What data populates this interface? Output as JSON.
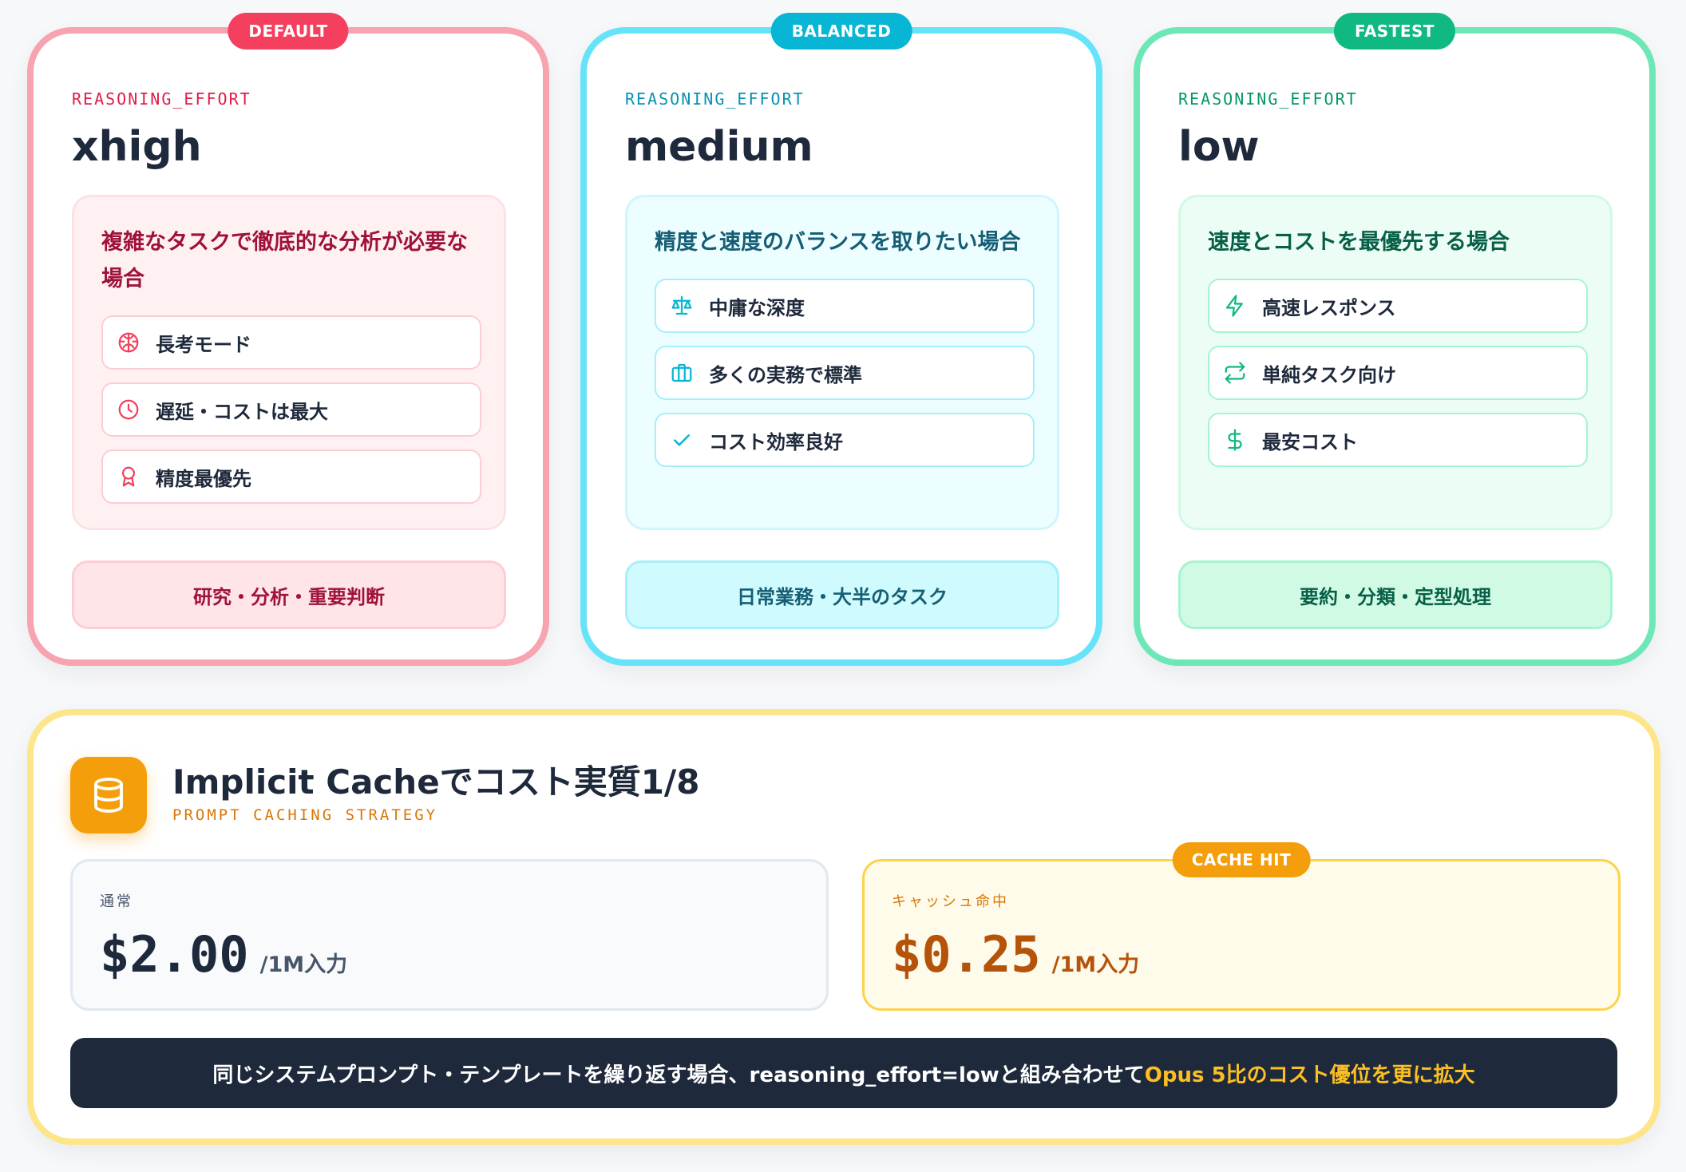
{
  "cards": [
    {
      "badge": "DEFAULT",
      "eyebrow": "REASONING_EFFORT",
      "level": "xhigh",
      "description": "複雑なタスクで徹底的な分析が必要な場合",
      "features": [
        {
          "icon": "brain-icon",
          "label": "長考モード"
        },
        {
          "icon": "clock-icon",
          "label": "遅延・コストは最大"
        },
        {
          "icon": "award-icon",
          "label": "精度最優先"
        }
      ],
      "use_case": "研究・分析・重要判断",
      "accent_color": "#f43f5e"
    },
    {
      "badge": "BALANCED",
      "eyebrow": "REASONING_EFFORT",
      "level": "medium",
      "description": "精度と速度のバランスを取りたい場合",
      "features": [
        {
          "icon": "scale-icon",
          "label": "中庸な深度"
        },
        {
          "icon": "briefcase-icon",
          "label": "多くの実務で標準"
        },
        {
          "icon": "check-icon",
          "label": "コスト効率良好"
        }
      ],
      "use_case": "日常業務・大半のタスク",
      "accent_color": "#06b6d4"
    },
    {
      "badge": "FASTEST",
      "eyebrow": "REASONING_EFFORT",
      "level": "low",
      "description": "速度とコストを最優先する場合",
      "features": [
        {
          "icon": "zap-icon",
          "label": "高速レスポンス"
        },
        {
          "icon": "repeat-icon",
          "label": "単純タスク向け"
        },
        {
          "icon": "dollar-icon",
          "label": "最安コスト"
        }
      ],
      "use_case": "要約・分類・定型処理",
      "accent_color": "#10b981"
    }
  ],
  "cache": {
    "icon": "database-icon",
    "title": "Implicit Cacheでコスト実質1/8",
    "subtitle": "PROMPT CACHING STRATEGY",
    "normal": {
      "label": "通常",
      "price": "$2.00",
      "unit": "/1M入力"
    },
    "hit": {
      "badge": "CACHE HIT",
      "label": "キャッシュ命中",
      "price": "$0.25",
      "unit": "/1M入力"
    },
    "note": {
      "text": "同じシステムプロンプト・テンプレートを繰り返す場合、reasoning_effort=lowと組み合わせて",
      "highlight": "Opus 5比のコスト優位を更に拡大"
    },
    "accent_color": "#f59e0b"
  }
}
